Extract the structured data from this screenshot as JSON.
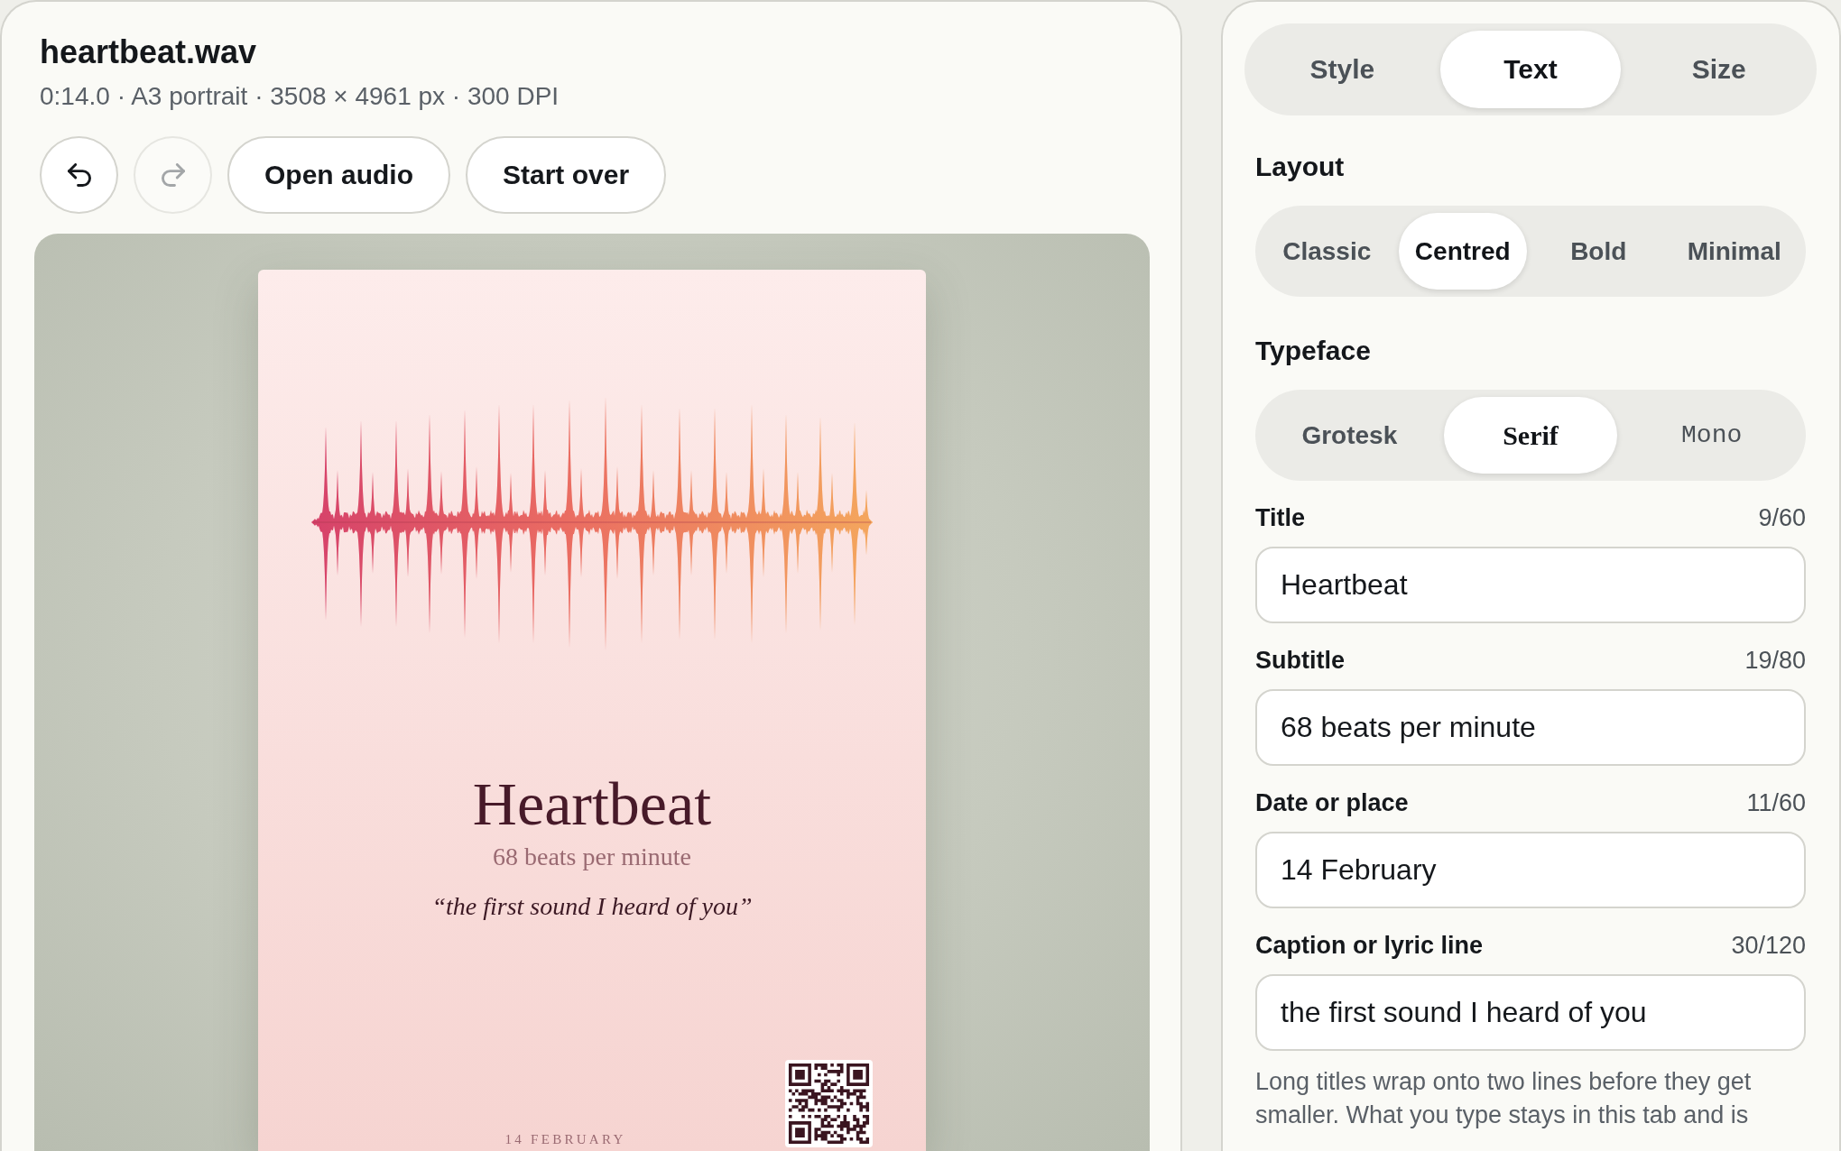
{
  "file": {
    "name": "heartbeat.wav",
    "meta": "0:14.0 · A3 portrait · 3508 × 4961 px · 300 DPI"
  },
  "toolbar": [
    {
      "kind": "undo",
      "disabled": false
    },
    {
      "kind": "redo",
      "disabled": true
    },
    {
      "kind": "open",
      "label": "Open audio",
      "disabled": false
    },
    {
      "kind": "reset",
      "label": "Start over",
      "disabled": false
    }
  ],
  "poster": {
    "title": "Heartbeat",
    "subtitle": "68 beats per minute",
    "caption": "“the first sound I heard of you”",
    "date": "14 FEBRUARY"
  },
  "tabs": [
    {
      "label": "Style",
      "selected": false
    },
    {
      "label": "Text",
      "selected": true
    },
    {
      "label": "Size",
      "selected": false
    }
  ],
  "layout": {
    "heading": "Layout",
    "options": [
      {
        "label": "Classic",
        "selected": false
      },
      {
        "label": "Centred",
        "selected": true
      },
      {
        "label": "Bold",
        "selected": false
      },
      {
        "label": "Minimal",
        "selected": false
      }
    ]
  },
  "typeface": {
    "heading": "Typeface",
    "options": [
      {
        "label": "Grotesk",
        "kind": "sans",
        "selected": false
      },
      {
        "label": "Serif",
        "kind": "serif",
        "selected": true
      },
      {
        "label": "Mono",
        "kind": "mono",
        "selected": false
      }
    ]
  },
  "fields": [
    {
      "label": "Title",
      "count": "9/60",
      "value": "Heartbeat"
    },
    {
      "label": "Subtitle",
      "count": "19/80",
      "value": "68 beats per minute"
    },
    {
      "label": "Date or place",
      "count": "11/60",
      "value": "14 February"
    },
    {
      "label": "Caption or lyric line",
      "count": "30/120",
      "value": "the first sound I heard of you"
    }
  ],
  "help": "Long titles wrap onto two lines before they get smaller. What you type stays in this tab and is"
}
